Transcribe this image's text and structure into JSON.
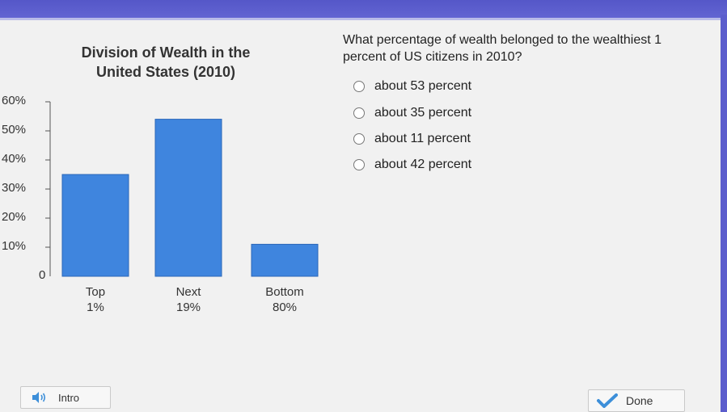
{
  "chart_data": {
    "type": "bar",
    "title": "Division of Wealth in the United States (2010)",
    "title_lines": [
      "Division of Wealth in the",
      "United States (2010)"
    ],
    "categories": [
      "Top 1%",
      "Next 19%",
      "Bottom 80%"
    ],
    "category_lines": [
      [
        "Top",
        "1%"
      ],
      [
        "Next",
        "19%"
      ],
      [
        "Bottom",
        "80%"
      ]
    ],
    "values": [
      35,
      54,
      11
    ],
    "ylim": [
      0,
      60
    ],
    "yticks": [
      "0",
      "10%",
      "20%",
      "30%",
      "40%",
      "50%",
      "60%"
    ],
    "ytick_values": [
      0,
      10,
      20,
      30,
      40,
      50,
      60
    ],
    "xlabel": "",
    "ylabel": "",
    "bar_color": "#3f85de",
    "bar_border": "#2a66b8",
    "grid": false
  },
  "question": {
    "text": "What percentage of wealth belonged to the wealthiest 1 percent of US citizens in 2010?",
    "options": [
      "about 53 percent",
      "about 35 percent",
      "about 11 percent",
      "about 42 percent"
    ]
  },
  "footer": {
    "intro_label": "Intro",
    "intro_icon": "speaker-icon",
    "done_label": "Done",
    "done_icon": "checkmark-icon",
    "check_color": "#3d8fd9"
  }
}
